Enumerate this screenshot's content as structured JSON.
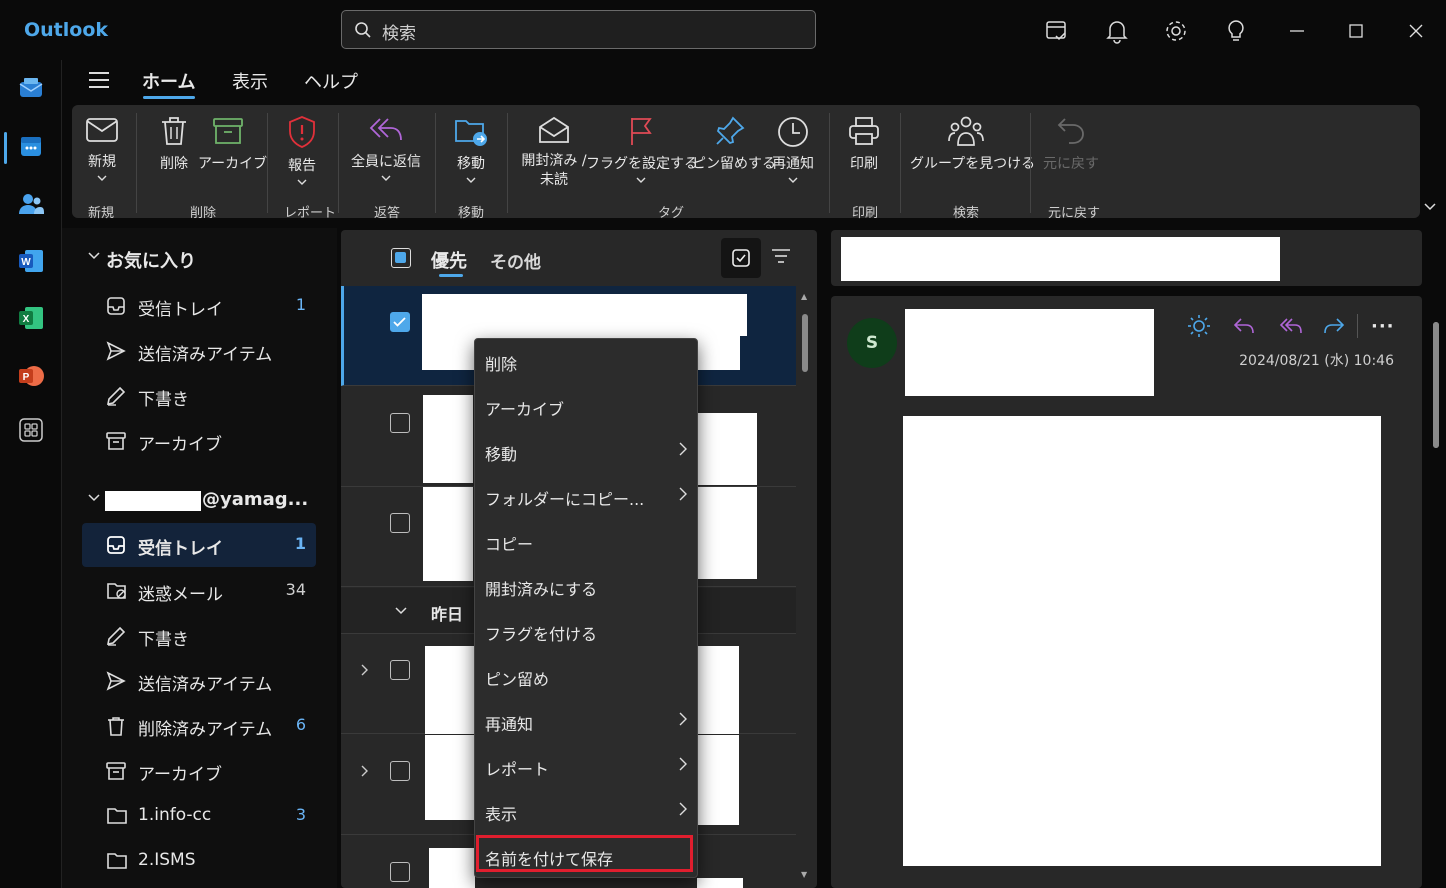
{
  "app": {
    "title": "Outlook"
  },
  "search": {
    "placeholder": "検索"
  },
  "tabs": [
    {
      "label": "ホーム"
    },
    {
      "label": "表示"
    },
    {
      "label": "ヘルプ"
    }
  ],
  "ribbon": {
    "new": {
      "label": "新規",
      "group": "新規"
    },
    "delete": {
      "label": "削除"
    },
    "archive": {
      "label": "アーカイブ"
    },
    "delete_group": "削除",
    "report": {
      "label": "報告",
      "group": "レポート"
    },
    "reply_all": {
      "label": "全員に返信",
      "group": "返答"
    },
    "move": {
      "label": "移動",
      "group": "移動"
    },
    "mark_read": {
      "label_line1": "開封済み /",
      "label_line2": "未読"
    },
    "flag": {
      "label": "フラグを設定する"
    },
    "pin": {
      "label": "ピン留めする"
    },
    "snooze": {
      "label": "再通知"
    },
    "tags_group": "タグ",
    "print": {
      "label": "印刷",
      "group": "印刷"
    },
    "find_groups": {
      "label": "グループを見つける",
      "group": "検索"
    },
    "undo": {
      "label": "元に戻す",
      "group": "元に戻す"
    }
  },
  "favorites": {
    "header": "お気に入り",
    "items": [
      {
        "label": "受信トレイ",
        "count": "1"
      },
      {
        "label": "送信済みアイテム",
        "count": ""
      },
      {
        "label": "下書き",
        "count": ""
      },
      {
        "label": "アーカイブ",
        "count": ""
      }
    ]
  },
  "account": {
    "header_suffix": "@yamag...",
    "items": [
      {
        "label": "受信トレイ",
        "count": "1"
      },
      {
        "label": "迷惑メール",
        "count": "34"
      },
      {
        "label": "下書き",
        "count": ""
      },
      {
        "label": "送信済みアイテム",
        "count": ""
      },
      {
        "label": "削除済みアイテム",
        "count": "6"
      },
      {
        "label": "アーカイブ",
        "count": ""
      },
      {
        "label": "1.info-cc",
        "count": "3"
      },
      {
        "label": "2.ISMS",
        "count": ""
      }
    ]
  },
  "message_list": {
    "tab_focused": "優先",
    "tab_other": "その他",
    "section_yesterday": "昨日"
  },
  "reader": {
    "avatar_initial": "S",
    "date": "2024/08/21 (水) 10:46"
  },
  "context_menu": {
    "items": [
      {
        "label": "削除"
      },
      {
        "label": "アーカイブ"
      },
      {
        "label": "移動"
      },
      {
        "label": "フォルダーにコピー..."
      },
      {
        "label": "コピー"
      },
      {
        "label": "開封済みにする"
      },
      {
        "label": "フラグを付ける"
      },
      {
        "label": "ピン留め"
      },
      {
        "label": "再通知"
      },
      {
        "label": "レポート"
      },
      {
        "label": "表示"
      },
      {
        "label": "名前を付けて保存"
      }
    ]
  },
  "colors": {
    "accent": "#4ea8ea",
    "highlight_box": "#e01e2e",
    "report_red": "#e0303a",
    "archive_green": "#6fb36a",
    "flag_red": "#e04a55",
    "reply_purple": "#b066d8"
  }
}
